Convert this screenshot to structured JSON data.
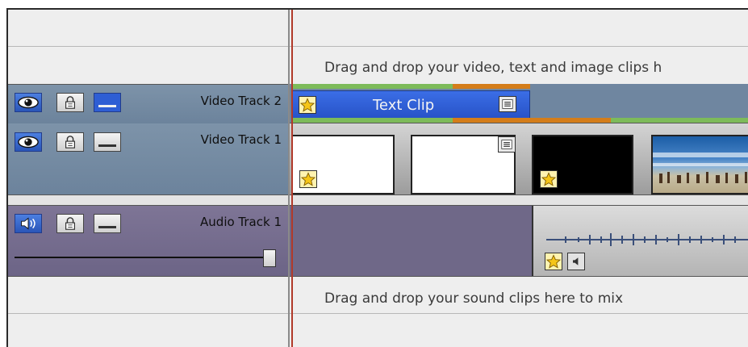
{
  "timeline": {
    "video_drop_hint": "Drag and drop your video, text and image clips h",
    "audio_drop_hint": "Drag and drop your sound clips here to mix"
  },
  "tracks": {
    "video2": {
      "label": "Video Track 2"
    },
    "video1": {
      "label": "Video Track 1"
    },
    "audio1": {
      "label": "Audio Track 1",
      "volume": 1.0
    }
  },
  "clips": {
    "text_clip": {
      "label": "Text Clip"
    }
  },
  "icons": {
    "visibility": "eye-icon",
    "lock": "lock-icon",
    "collapse": "minimize-icon",
    "speaker": "speaker-icon",
    "effects": "star-icon",
    "properties": "list-icon",
    "mute": "mute-icon"
  },
  "colors": {
    "video_track_bg": "#7d93a9",
    "audio_track_bg": "#7e7596",
    "text_clip": "#2e5ed4",
    "bar_green": "#7dbb5a",
    "bar_orange": "#d47d1a",
    "playhead": "#b13a2a"
  }
}
